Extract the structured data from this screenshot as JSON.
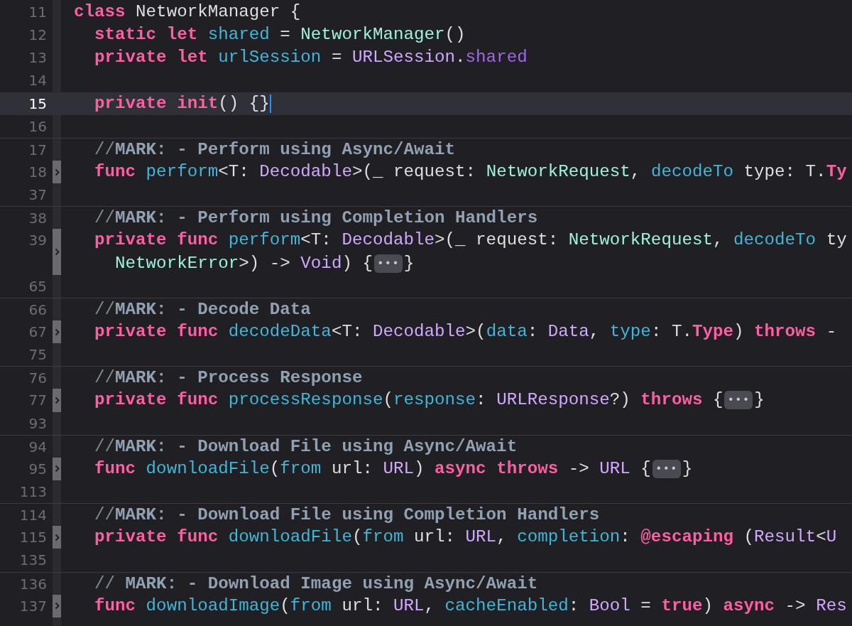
{
  "editor": {
    "lines": [
      {
        "number": "11",
        "current": false,
        "folded": false,
        "divider_above": false,
        "tokens": [
          {
            "text": "class",
            "kind": "keyword"
          },
          {
            "text": " NetworkManager {",
            "kind": "plain"
          }
        ]
      },
      {
        "number": "12",
        "current": false,
        "folded": false,
        "divider_above": false,
        "tokens": [
          {
            "text": "  static let ",
            "kind": "keyword"
          },
          {
            "text": "shared",
            "kind": "declaration"
          },
          {
            "text": " = ",
            "kind": "plain"
          },
          {
            "text": "NetworkManager",
            "kind": "project_type"
          },
          {
            "text": "()",
            "kind": "plain"
          }
        ]
      },
      {
        "number": "13",
        "current": false,
        "folded": false,
        "divider_above": false,
        "tokens": [
          {
            "text": "  private let ",
            "kind": "keyword"
          },
          {
            "text": "urlSession",
            "kind": "declaration"
          },
          {
            "text": " = ",
            "kind": "plain"
          },
          {
            "text": "URLSession",
            "kind": "type"
          },
          {
            "text": ".",
            "kind": "plain"
          },
          {
            "text": "shared",
            "kind": "property"
          }
        ]
      },
      {
        "number": "14",
        "current": false,
        "folded": false,
        "divider_above": false
      },
      {
        "number": "15",
        "current": true,
        "folded": false,
        "divider_above": false,
        "tokens": [
          {
            "text": "  private init",
            "kind": "keyword"
          },
          {
            "text": "() {}",
            "kind": "plain"
          }
        ]
      },
      {
        "number": "16",
        "current": false,
        "folded": false,
        "divider_above": false
      },
      {
        "number": "17",
        "current": false,
        "folded": false,
        "divider_above": true,
        "tokens": [
          {
            "text": "  //",
            "kind": "comment"
          },
          {
            "text": "MARK: - Perform using Async/Await",
            "kind": "mark"
          }
        ]
      },
      {
        "number": "18",
        "current": false,
        "folded": true,
        "divider_above": false,
        "tokens": [
          {
            "text": "  func ",
            "kind": "keyword"
          },
          {
            "text": "perform",
            "kind": "declaration"
          },
          {
            "text": "<T: ",
            "kind": "plain"
          },
          {
            "text": "Decodable",
            "kind": "type"
          },
          {
            "text": ">(_ request: ",
            "kind": "plain"
          },
          {
            "text": "NetworkRequest",
            "kind": "project_type"
          },
          {
            "text": ", ",
            "kind": "plain"
          },
          {
            "text": "decodeTo",
            "kind": "declaration"
          },
          {
            "text": " type: T.",
            "kind": "plain"
          },
          {
            "text": "Ty",
            "kind": "keyword"
          }
        ]
      },
      {
        "number": "37",
        "current": false,
        "folded": false,
        "divider_above": false
      },
      {
        "number": "38",
        "current": false,
        "folded": false,
        "divider_above": true,
        "tokens": [
          {
            "text": "  //",
            "kind": "comment"
          },
          {
            "text": "MARK: - Perform using Completion Handlers",
            "kind": "mark"
          }
        ]
      },
      {
        "number": "39",
        "current": false,
        "folded": true,
        "divider_above": false,
        "tokens": [
          {
            "text": "  private func ",
            "kind": "keyword"
          },
          {
            "text": "perform",
            "kind": "declaration"
          },
          {
            "text": "<T: ",
            "kind": "plain"
          },
          {
            "text": "Decodable",
            "kind": "type"
          },
          {
            "text": ">(_ request: ",
            "kind": "plain"
          },
          {
            "text": "NetworkRequest",
            "kind": "project_type"
          },
          {
            "text": ", ",
            "kind": "plain"
          },
          {
            "text": "decodeTo",
            "kind": "declaration"
          },
          {
            "text": " ty",
            "kind": "plain"
          }
        ],
        "wrapped": [
          {
            "text": "    NetworkError",
            "kind": "project_type"
          },
          {
            "text": ">) -> ",
            "kind": "plain"
          },
          {
            "text": "Void",
            "kind": "type"
          },
          {
            "text": ") {",
            "kind": "plain"
          },
          {
            "text": "•••",
            "kind": "collapsed"
          },
          {
            "text": "}",
            "kind": "plain"
          }
        ]
      },
      {
        "number": "65",
        "current": false,
        "folded": false,
        "divider_above": false
      },
      {
        "number": "66",
        "current": false,
        "folded": false,
        "divider_above": true,
        "tokens": [
          {
            "text": "  //",
            "kind": "comment"
          },
          {
            "text": "MARK: - Decode Data",
            "kind": "mark"
          }
        ]
      },
      {
        "number": "67",
        "current": false,
        "folded": true,
        "divider_above": false,
        "tokens": [
          {
            "text": "  private func ",
            "kind": "keyword"
          },
          {
            "text": "decodeData",
            "kind": "declaration"
          },
          {
            "text": "<T: ",
            "kind": "plain"
          },
          {
            "text": "Decodable",
            "kind": "type"
          },
          {
            "text": ">(",
            "kind": "plain"
          },
          {
            "text": "data",
            "kind": "declaration"
          },
          {
            "text": ": ",
            "kind": "plain"
          },
          {
            "text": "Data",
            "kind": "type"
          },
          {
            "text": ", ",
            "kind": "plain"
          },
          {
            "text": "type",
            "kind": "declaration"
          },
          {
            "text": ": T.",
            "kind": "plain"
          },
          {
            "text": "Type",
            "kind": "keyword"
          },
          {
            "text": ") ",
            "kind": "plain"
          },
          {
            "text": "throws",
            "kind": "keyword"
          },
          {
            "text": " -",
            "kind": "plain"
          }
        ]
      },
      {
        "number": "75",
        "current": false,
        "folded": false,
        "divider_above": false
      },
      {
        "number": "76",
        "current": false,
        "folded": false,
        "divider_above": true,
        "tokens": [
          {
            "text": "  //",
            "kind": "comment"
          },
          {
            "text": "MARK: - Process Response",
            "kind": "mark"
          }
        ]
      },
      {
        "number": "77",
        "current": false,
        "folded": true,
        "divider_above": false,
        "tokens": [
          {
            "text": "  private func ",
            "kind": "keyword"
          },
          {
            "text": "processResponse",
            "kind": "declaration"
          },
          {
            "text": "(",
            "kind": "plain"
          },
          {
            "text": "response",
            "kind": "declaration"
          },
          {
            "text": ": ",
            "kind": "plain"
          },
          {
            "text": "URLResponse",
            "kind": "type"
          },
          {
            "text": "?) ",
            "kind": "plain"
          },
          {
            "text": "throws",
            "kind": "keyword"
          },
          {
            "text": " {",
            "kind": "plain"
          },
          {
            "text": "•••",
            "kind": "collapsed"
          },
          {
            "text": "}",
            "kind": "plain"
          }
        ]
      },
      {
        "number": "93",
        "current": false,
        "folded": false,
        "divider_above": false
      },
      {
        "number": "94",
        "current": false,
        "folded": false,
        "divider_above": true,
        "tokens": [
          {
            "text": "  //",
            "kind": "comment"
          },
          {
            "text": "MARK: - Download File using Async/Await",
            "kind": "mark"
          }
        ]
      },
      {
        "number": "95",
        "current": false,
        "folded": true,
        "divider_above": false,
        "tokens": [
          {
            "text": "  func ",
            "kind": "keyword"
          },
          {
            "text": "downloadFile",
            "kind": "declaration"
          },
          {
            "text": "(",
            "kind": "plain"
          },
          {
            "text": "from",
            "kind": "declaration"
          },
          {
            "text": " url: ",
            "kind": "plain"
          },
          {
            "text": "URL",
            "kind": "type"
          },
          {
            "text": ") ",
            "kind": "plain"
          },
          {
            "text": "async throws",
            "kind": "keyword"
          },
          {
            "text": " -> ",
            "kind": "plain"
          },
          {
            "text": "URL",
            "kind": "type"
          },
          {
            "text": " {",
            "kind": "plain"
          },
          {
            "text": "•••",
            "kind": "collapsed"
          },
          {
            "text": "}",
            "kind": "plain"
          }
        ]
      },
      {
        "number": "113",
        "current": false,
        "folded": false,
        "divider_above": false
      },
      {
        "number": "114",
        "current": false,
        "folded": false,
        "divider_above": true,
        "tokens": [
          {
            "text": "  //",
            "kind": "comment"
          },
          {
            "text": "MARK: - Download File using Completion Handlers",
            "kind": "mark"
          }
        ]
      },
      {
        "number": "115",
        "current": false,
        "folded": true,
        "divider_above": false,
        "tokens": [
          {
            "text": "  private func ",
            "kind": "keyword"
          },
          {
            "text": "downloadFile",
            "kind": "declaration"
          },
          {
            "text": "(",
            "kind": "plain"
          },
          {
            "text": "from",
            "kind": "declaration"
          },
          {
            "text": " url: ",
            "kind": "plain"
          },
          {
            "text": "URL",
            "kind": "type"
          },
          {
            "text": ", ",
            "kind": "plain"
          },
          {
            "text": "completion",
            "kind": "declaration"
          },
          {
            "text": ": ",
            "kind": "plain"
          },
          {
            "text": "@escaping",
            "kind": "keyword"
          },
          {
            "text": " (",
            "kind": "plain"
          },
          {
            "text": "Result",
            "kind": "type"
          },
          {
            "text": "<",
            "kind": "plain"
          },
          {
            "text": "U",
            "kind": "type"
          }
        ]
      },
      {
        "number": "135",
        "current": false,
        "folded": false,
        "divider_above": false
      },
      {
        "number": "136",
        "current": false,
        "folded": false,
        "divider_above": true,
        "tokens": [
          {
            "text": "  // ",
            "kind": "comment"
          },
          {
            "text": "MARK: - Download Image using Async/Await",
            "kind": "mark"
          }
        ]
      },
      {
        "number": "137",
        "current": false,
        "folded": true,
        "divider_above": false,
        "tokens": [
          {
            "text": "  func ",
            "kind": "keyword"
          },
          {
            "text": "downloadImage",
            "kind": "declaration"
          },
          {
            "text": "(",
            "kind": "plain"
          },
          {
            "text": "from",
            "kind": "declaration"
          },
          {
            "text": " url: ",
            "kind": "plain"
          },
          {
            "text": "URL",
            "kind": "type"
          },
          {
            "text": ", ",
            "kind": "plain"
          },
          {
            "text": "cacheEnabled",
            "kind": "declaration"
          },
          {
            "text": ": ",
            "kind": "plain"
          },
          {
            "text": "Bool",
            "kind": "type"
          },
          {
            "text": " = ",
            "kind": "plain"
          },
          {
            "text": "true",
            "kind": "keyword"
          },
          {
            "text": ") ",
            "kind": "plain"
          },
          {
            "text": "async",
            "kind": "keyword"
          },
          {
            "text": " -> ",
            "kind": "plain"
          },
          {
            "text": "Res",
            "kind": "type"
          }
        ]
      }
    ]
  }
}
